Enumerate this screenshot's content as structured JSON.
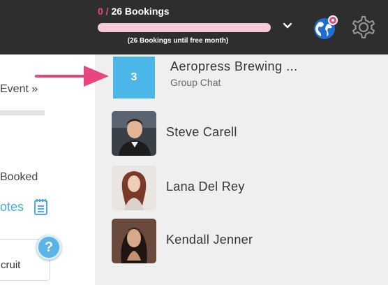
{
  "header": {
    "bookings_done": "0",
    "bookings_sep": " / ",
    "bookings_total_label": "26 Bookings",
    "progress_fraction": 0,
    "bookings_subtitle": "(26 Bookings until free month)"
  },
  "left": {
    "event_label": "Event »",
    "booked_label": "Booked",
    "notes_label": "otes",
    "recruit_label": "cruit",
    "help_label": "?"
  },
  "conversations": [
    {
      "type": "group",
      "badge": "3",
      "title": "Aeropress Brewing ...",
      "subtitle": "Group Chat"
    },
    {
      "type": "person",
      "name": "Steve Carell",
      "avatar": "avatar-steve"
    },
    {
      "type": "person",
      "name": "Lana Del Rey",
      "avatar": "avatar-lana"
    },
    {
      "type": "person",
      "name": "Kendall Jenner",
      "avatar": "avatar-kendall"
    }
  ],
  "colors": {
    "accent_pink": "#e9467f",
    "accent_blue": "#4ab7e8",
    "topbar": "#2e2e2e"
  }
}
